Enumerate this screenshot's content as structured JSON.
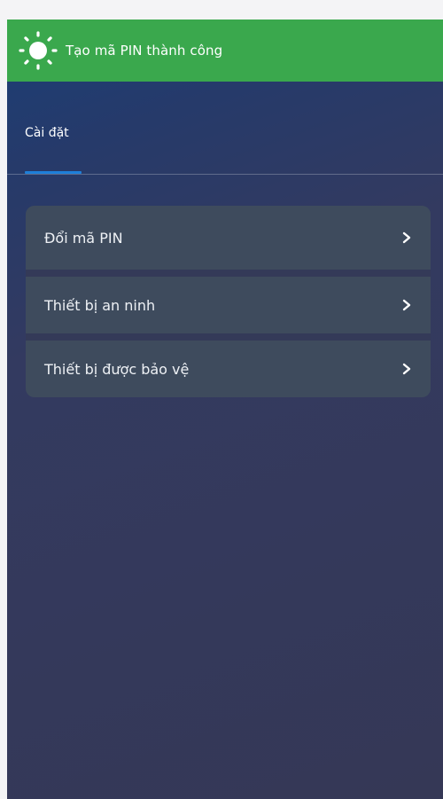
{
  "toast": {
    "icon": "sun-icon",
    "message": "Tạo mã PIN thành công",
    "color": "#3aa84d"
  },
  "tabs": [
    {
      "label": "Cài đặt",
      "active": true
    }
  ],
  "menu": {
    "items": [
      {
        "label": "Đổi mã PIN",
        "icon": "chevron-right-icon"
      },
      {
        "label": "Thiết bị an ninh",
        "icon": "chevron-right-icon"
      },
      {
        "label": "Thiết bị được bảo vệ",
        "icon": "chevron-right-icon"
      }
    ]
  },
  "colors": {
    "accent": "#1e7fd9",
    "background": "#353856",
    "card": "#3e4b5d"
  }
}
